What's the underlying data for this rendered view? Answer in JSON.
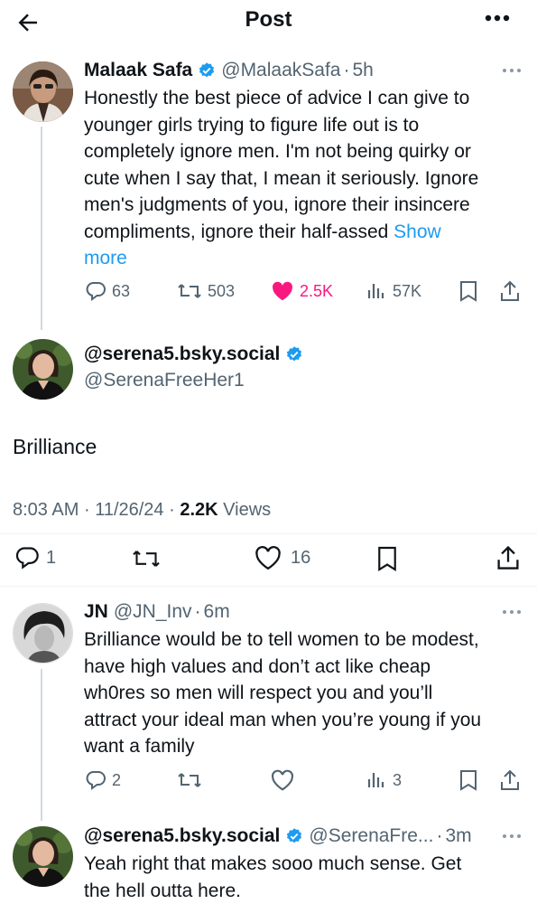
{
  "header": {
    "title": "Post"
  },
  "tweet1": {
    "name": "Malaak Safa",
    "handle": "@MalaakSafa",
    "sep": "·",
    "time": "5h",
    "lines": [
      "Honestly the best piece of advice I can give to",
      "younger girls trying to figure life out is to",
      "completely ignore men. I'm not being quirky or",
      "cute when I say that, I mean it seriously. Ignore",
      "men's judgments of you, ignore their insincere",
      "compliments, ignore their half-assed"
    ],
    "show_more_a": "Show",
    "show_more_b": "more",
    "replies": "63",
    "reposts": "503",
    "likes": "2.5K",
    "views": "57K"
  },
  "main": {
    "name": "@serena5.bsky.social",
    "handle": "@SerenaFreeHer1",
    "text": "Brilliance",
    "time": "8:03 AM",
    "dot": "·",
    "date": "11/26/24",
    "views_count": "2.2K",
    "views_label": "Views",
    "replies": "1",
    "likes": "16"
  },
  "reply1": {
    "name": "JN",
    "handle": "@JN_Inv",
    "sep": "·",
    "time": "6m",
    "lines": [
      "Brilliance would be to tell women to be modest,",
      "have high values and don’t act like cheap",
      "wh0res so men will respect you and you’ll",
      "attract your ideal man when you’re young if you",
      "want a family"
    ],
    "replies": "2",
    "views": "3"
  },
  "reply2": {
    "name": "@serena5.bsky.social",
    "handle": "@SerenaFre...",
    "sep": "·",
    "time": "3m",
    "lines": [
      "Yeah right that makes sooo much sense. Get",
      "the hell outta here."
    ]
  },
  "colors": {
    "accent": "#1d9bf0",
    "like": "#f91880",
    "muted": "#536471",
    "text": "#0f1419"
  }
}
